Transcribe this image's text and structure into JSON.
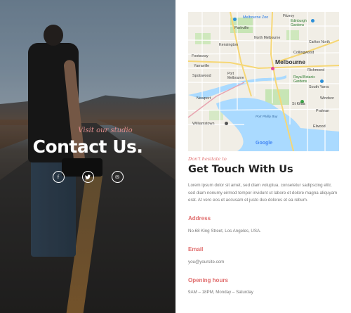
{
  "hero": {
    "eyebrow": "Visit our studio",
    "title": "Contact Us.",
    "social_icons": [
      {
        "icon": "facebook-icon",
        "glyph": "f"
      },
      {
        "icon": "twitter-icon",
        "glyph": "t"
      },
      {
        "icon": "email-icon",
        "glyph": "✉"
      }
    ]
  },
  "map": {
    "labels": {
      "melbourne_zoo": "Melbourne Zoo",
      "fitzroy": "Fitzroy",
      "edinburgh_gardens": "Edinburgh Gardens",
      "parkville": "Parkville",
      "north_melbourne": "North Melbourne",
      "carlton_north": "Carlton North",
      "kensington": "Kensington",
      "collingwood": "Collingwood",
      "footscray": "Footscray",
      "yarraville": "Yarraville",
      "melbourne": "Melbourne",
      "richmond": "Richmond",
      "spotswood": "Spotswood",
      "port_melbourne": "Port Melbourne",
      "south_yarra": "South Yarra",
      "royal_botanic": "Royal Botanic Gardens",
      "newport": "Newport",
      "st_kilda": "St Kilda",
      "prahran": "Prahran",
      "elwood": "Elwood",
      "williamstown": "Williamstown",
      "windsor": "Windsor",
      "port_phillip_bay": "Port Phillip Bay",
      "google": "Google"
    }
  },
  "contact": {
    "script_label": "Don't hesitate to",
    "heading": "Get Touch With Us",
    "paragraph": "Lorem ipsum dolor sit amet, sed diam voluptua. consetetur sadipscing elitr, sed diam nonumy eirmod tempor invidunt ut labore et dolore magna aliquyam erat. At vero eos et accusam et justo duo dolores et ea rebum.",
    "address_label": "Address",
    "address_value": "No.68 King Street, Los Angeles, USA.",
    "email_label": "Email",
    "email_value": "you@yoursite.com",
    "hours_label": "Opening hours",
    "hours_value": "9AM – 18PM, Monday – Saturday"
  },
  "colors": {
    "accent": "#e06d6d"
  }
}
